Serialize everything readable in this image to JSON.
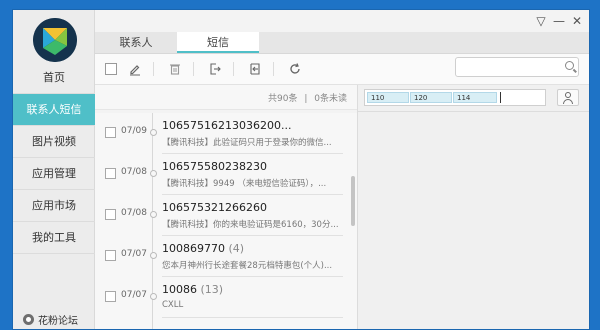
{
  "window": {
    "controls": [
      "▽",
      "—",
      "✕"
    ]
  },
  "sidebar": {
    "items": [
      {
        "label": "首页"
      },
      {
        "label": "联系人短信"
      },
      {
        "label": "图片视频"
      },
      {
        "label": "应用管理"
      },
      {
        "label": "应用市场"
      },
      {
        "label": "我的工具"
      }
    ],
    "active_index": 1,
    "footer_label": "花粉论坛"
  },
  "tabs": {
    "contacts": "联系人",
    "sms": "短信",
    "active": "sms"
  },
  "toolbar": {
    "icons": [
      "checkbox",
      "edit-icon",
      "delete-icon",
      "export-icon",
      "import-icon",
      "refresh-icon"
    ],
    "search_placeholder": ""
  },
  "list_header": {
    "total": "共90条",
    "separator": "|",
    "unread": "0条未读"
  },
  "messages": [
    {
      "date": "07/09",
      "number": "10657516213036200...",
      "count": "",
      "preview": "【腾讯科技】此验证码只用于登录你的微信..."
    },
    {
      "date": "07/08",
      "number": "106575580238230",
      "count": "",
      "preview": "【腾讯科技】9949 （来电短信验证码），..."
    },
    {
      "date": "07/08",
      "number": "106575321266260",
      "count": "",
      "preview": "【腾讯科技】你的来电验证码是6160，30分..."
    },
    {
      "date": "07/07",
      "number": "100869770",
      "count": "(4)",
      "preview": "您本月神州行长途套餐28元档特惠包(个人)..."
    },
    {
      "date": "07/07",
      "number": "10086",
      "count": "(13)",
      "preview": "CXLL"
    }
  ],
  "compose": {
    "recipients": [
      "110",
      "120",
      "114"
    ]
  },
  "colors": {
    "accent": "#4fbfc8",
    "desktop": "#1e73c6"
  }
}
